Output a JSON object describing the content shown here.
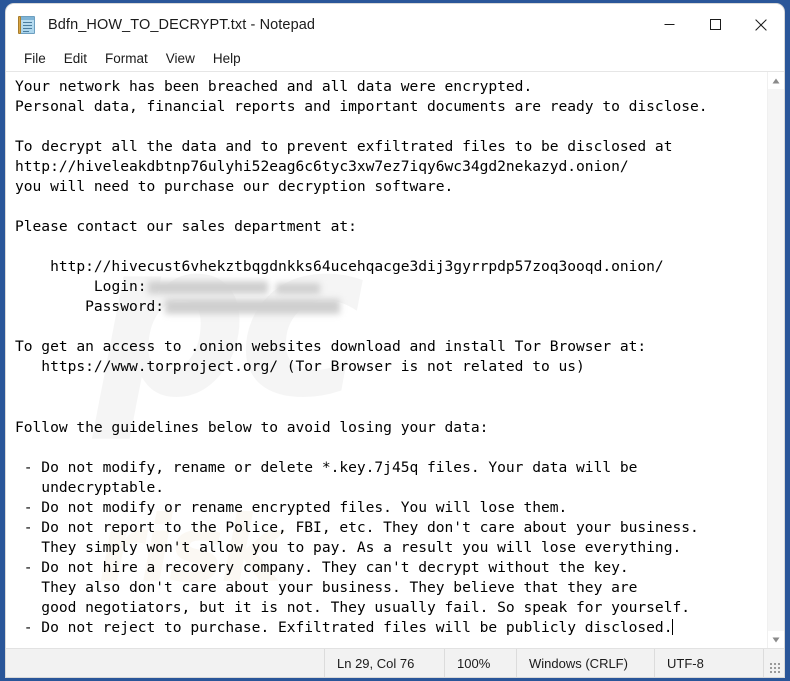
{
  "window": {
    "title": "Bdfn_HOW_TO_DECRYPT.txt - Notepad",
    "icon": "notepad-icon",
    "controls": {
      "minimize": "minimize-icon",
      "maximize": "maximize-icon",
      "close": "close-icon"
    }
  },
  "menu": {
    "items": [
      {
        "label": "File"
      },
      {
        "label": "Edit"
      },
      {
        "label": "Format"
      },
      {
        "label": "View"
      },
      {
        "label": "Help"
      }
    ]
  },
  "document": {
    "lines": {
      "l01": "Your network has been breached and all data were encrypted.",
      "l02": "Personal data, financial reports and important documents are ready to disclose.",
      "l03": "",
      "l04": "To decrypt all the data and to prevent exfiltrated files to be disclosed at",
      "l05": "http://hiveleakdbtnp76ulyhi52eag6c6tyc3xw7ez7iqy6wc34gd2nekazyd.onion/",
      "l06": "you will need to purchase our decryption software.",
      "l07": "",
      "l08": "Please contact our sales department at:",
      "l09": "",
      "l10": "    http://hivecust6vhekztbqgdnkks64ucehqacge3dij3gyrrpdp57zoq3ooqd.onion/",
      "l11": "",
      "l12_label": "        Login:",
      "l13_label": "        Password:",
      "l14": "",
      "l15": "To get an access to .onion websites download and install Tor Browser at:",
      "l16": "   https://www.torproject.org/ (Tor Browser is not related to us)",
      "l17": "",
      "l18": "",
      "l19": "Follow the guidelines below to avoid losing your data:",
      "l20": "",
      "l21": " - Do not modify, rename or delete *.key.7j45q files. Your data will be",
      "l22": "   undecryptable.",
      "l23": " - Do not modify or rename encrypted files. You will lose them.",
      "l24": " - Do not report to the Police, FBI, etc. They don't care about your business.",
      "l25": "   They simply won't allow you to pay. As a result you will lose everything.",
      "l26": " - Do not hire a recovery company. They can't decrypt without the key.",
      "l27": "   They also don't care about your business. They believe that they are",
      "l28": "   good negotiators, but it is not. They usually fail. So speak for yourself.",
      "l29": " - Do not reject to purchase. Exfiltrated files will be publicly disclosed."
    },
    "redacted": {
      "login_note": "redacted",
      "password_note": "redacted"
    }
  },
  "watermark": {
    "big": "pc",
    "small": "risk"
  },
  "statusbar": {
    "cursor": "Ln 29, Col 76",
    "zoom": "100%",
    "line_ending": "Windows (CRLF)",
    "encoding": "UTF-8"
  },
  "colors": {
    "desktop": "#2a5699",
    "titlebar": "#ffffff",
    "statusbar": "#f2f2f2",
    "text": "#000000"
  }
}
